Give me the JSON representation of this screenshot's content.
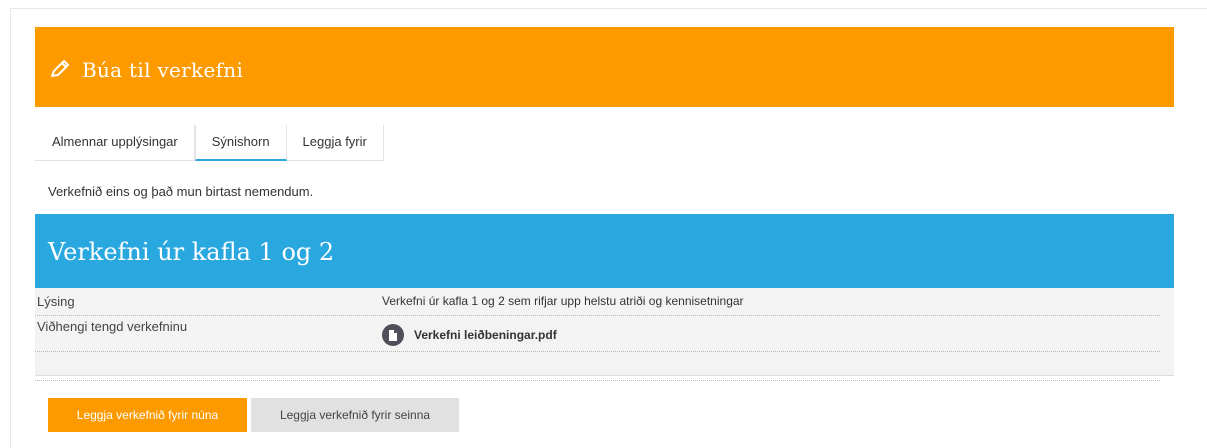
{
  "header": {
    "title": "Búa til verkefni",
    "icon": "pencil-icon"
  },
  "tabs": [
    {
      "label": "Almennar upplýsingar"
    },
    {
      "label": "Sýnishorn"
    },
    {
      "label": "Leggja fyrir"
    }
  ],
  "active_tab": "Sýnishorn",
  "intro_text": "Verkefnið eins og það mun birtast nemendum.",
  "task": {
    "title": "Verkefni úr kafla 1 og 2",
    "description_label": "Lýsing",
    "description_value": "Verkefni úr kafla 1 og 2 sem rifjar upp helstu atriði og kennisetningar",
    "attachments_label": "Viðhengi tengd verkefninu",
    "attachment_name": "Verkefni leiðbeningar.pdf",
    "attachment_icon": "file-icon"
  },
  "buttons": {
    "assign_now": "Leggja verkefnið fyrir núna",
    "assign_later": "Leggja verkefnið fyrir seinna"
  },
  "colors": {
    "accent_orange": "#fd9a00",
    "accent_blue": "#29a8e0",
    "tab_underline": "#2aa7e0"
  }
}
